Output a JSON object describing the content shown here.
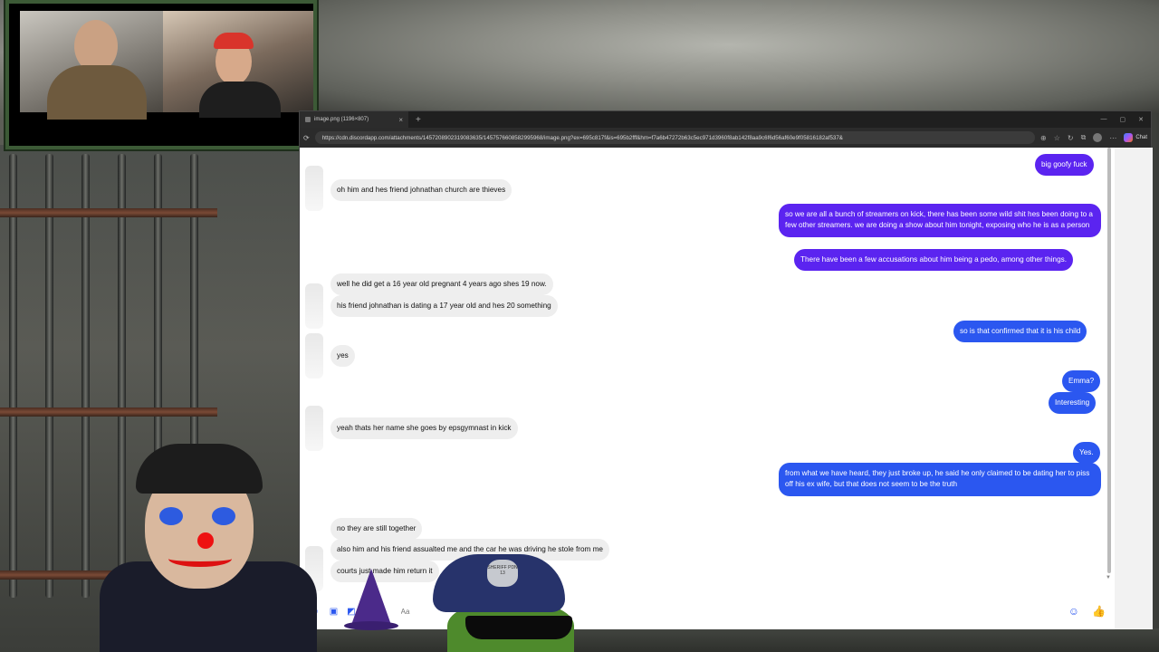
{
  "browser": {
    "tab_title": "image.png (1196×807)",
    "tab_close": "×",
    "new_tab": "+",
    "url": "https://cdn.discordapp.com/attachments/1457208902319083635/1457576608582995968/image.png?ex=695c817f&is=695b2fff&hm=f7a6b47272b63c5ec971d3960f8ab142f8aa9c6f6d56af60e9f05816182af537&",
    "chat_label": "Chat"
  },
  "conversation": {
    "messages": [
      {
        "dir": "out",
        "text": "big goofy fuck"
      },
      {
        "dir": "in",
        "text": "oh him and hes friend johnathan church are thieves"
      },
      {
        "dir": "out",
        "text": "so we are all a bunch of streamers on kick,  there has been some wild shit hes been doing to a few other streamers.  we are doing a show about him tonight,  exposing who he is as a person"
      },
      {
        "dir": "out",
        "text": "There have been a few accusations about him being a pedo, among other things."
      },
      {
        "dir": "in",
        "text": "well he did get a 16 year old pregnant 4 years ago shes 19 now."
      },
      {
        "dir": "in",
        "text": "his friend johnathan is dating a 17 year old and hes 20 something"
      },
      {
        "dir": "out",
        "text": "so is that confirmed that it is his child"
      },
      {
        "dir": "in",
        "text": "yes"
      },
      {
        "dir": "out",
        "text": "Emma?"
      },
      {
        "dir": "out",
        "text": "Interesting"
      },
      {
        "dir": "in",
        "text": "yeah thats her name she goes by epsgymnast in kick"
      },
      {
        "dir": "out",
        "text": "Yes."
      },
      {
        "dir": "out",
        "text": "from what we have heard, they just broke up, he said he only claimed to be dating her to piss off his ex wife, but that does not seem to be the truth"
      },
      {
        "dir": "in",
        "text": "no they are still together"
      },
      {
        "dir": "in",
        "text": "also him and his friend assualted me and the car he was driving he stole from me"
      },
      {
        "dir": "in",
        "text": "courts just made him return it"
      }
    ]
  },
  "composer": {
    "placeholder": "Aa",
    "icons": [
      "microphone-icon",
      "image-icon",
      "sticker-icon",
      "emoji-icon",
      "thumbs-up-icon"
    ]
  },
  "overlay": {
    "badge_text": "SHERIFF PDN 13"
  },
  "colors": {
    "outgoing_purple": "#5b24f0",
    "outgoing_blue": "#2b57f0",
    "incoming_gray": "#eeeeee",
    "frame_green": "#3c5a36"
  }
}
